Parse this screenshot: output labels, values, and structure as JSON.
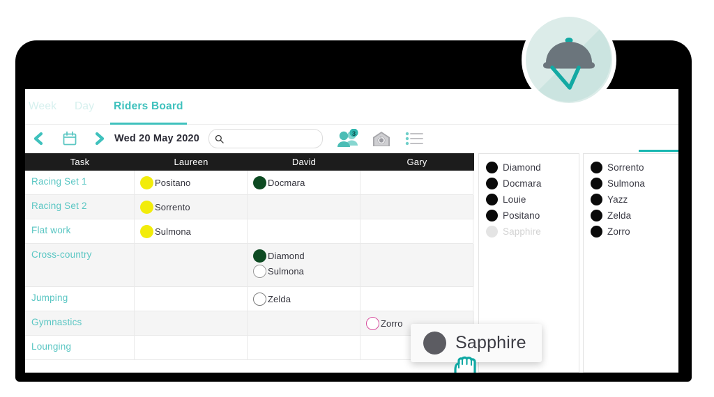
{
  "app": {
    "title": "Riders Board",
    "accent_color": "#3fc1bd",
    "header_bg": "#1c1c1c"
  },
  "tabs": [
    {
      "label": "Week",
      "active": false
    },
    {
      "label": "Day",
      "active": false
    },
    {
      "label": "Riders Board",
      "active": true
    }
  ],
  "toolbar": {
    "prev_label": "previous",
    "next_label": "next",
    "calendar_label": "calendar",
    "date": "Wed 20 May 2020",
    "search": {
      "value": "",
      "placeholder": ""
    },
    "people_badge": "3",
    "icons": [
      "people-icon",
      "barn-icon",
      "list-icon"
    ]
  },
  "board": {
    "columns": [
      "Task",
      "Laureen",
      "David",
      "Gary"
    ],
    "rows": [
      {
        "task": "Racing Set 1",
        "laureen": [
          {
            "name": "Positano",
            "color": "#f2ec0a",
            "style": "filled"
          }
        ],
        "david": [
          {
            "name": "Docmara",
            "color": "#0d4a22",
            "style": "filled"
          }
        ],
        "gary": []
      },
      {
        "task": "Racing Set 2",
        "laureen": [
          {
            "name": "Sorrento",
            "color": "#f2ec0a",
            "style": "filled"
          }
        ],
        "david": [],
        "gary": []
      },
      {
        "task": "Flat work",
        "laureen": [
          {
            "name": "Sulmona",
            "color": "#f2ec0a",
            "style": "filled"
          }
        ],
        "david": [],
        "gary": []
      },
      {
        "task": "Cross-country",
        "laureen": [],
        "david": [
          {
            "name": "Diamond",
            "color": "#0d4a22",
            "style": "filled"
          },
          {
            "name": "Sulmona",
            "color": "#9a9a9a",
            "style": "outline"
          }
        ],
        "gary": []
      },
      {
        "task": "Jumping",
        "laureen": [],
        "david": [
          {
            "name": "Zelda",
            "color": "#7c7c7c",
            "style": "outline"
          }
        ],
        "gary": []
      },
      {
        "task": "Gymnastics",
        "laureen": [],
        "david": [],
        "gary": [
          {
            "name": "Zorro",
            "color": "#d74f9e",
            "style": "outline"
          }
        ]
      },
      {
        "task": "Lounging",
        "laureen": [],
        "david": [],
        "gary": []
      }
    ]
  },
  "panels": [
    {
      "name": "horse-list-a",
      "items": [
        {
          "label": "Diamond",
          "ghost": false
        },
        {
          "label": "Docmara",
          "ghost": false
        },
        {
          "label": "Louie",
          "ghost": false
        },
        {
          "label": "Positano",
          "ghost": false
        },
        {
          "label": "Sapphire",
          "ghost": true
        }
      ]
    },
    {
      "name": "horse-list-b",
      "items": [
        {
          "label": "Sorrento",
          "ghost": false
        },
        {
          "label": "Sulmona",
          "ghost": false
        },
        {
          "label": "Yazz",
          "ghost": false
        },
        {
          "label": "Zelda",
          "ghost": false
        },
        {
          "label": "Zorro",
          "ghost": false
        }
      ]
    }
  ],
  "drag": {
    "label": "Sapphire",
    "dot_color": "#5c5c62",
    "cursor": "grabbing-hand-cursor"
  },
  "badge": {
    "icon": "riding-helmet-icon",
    "circle_color": "#d9ece8",
    "helmet_color": "#6b757c",
    "strap_color": "#13a9a3"
  }
}
